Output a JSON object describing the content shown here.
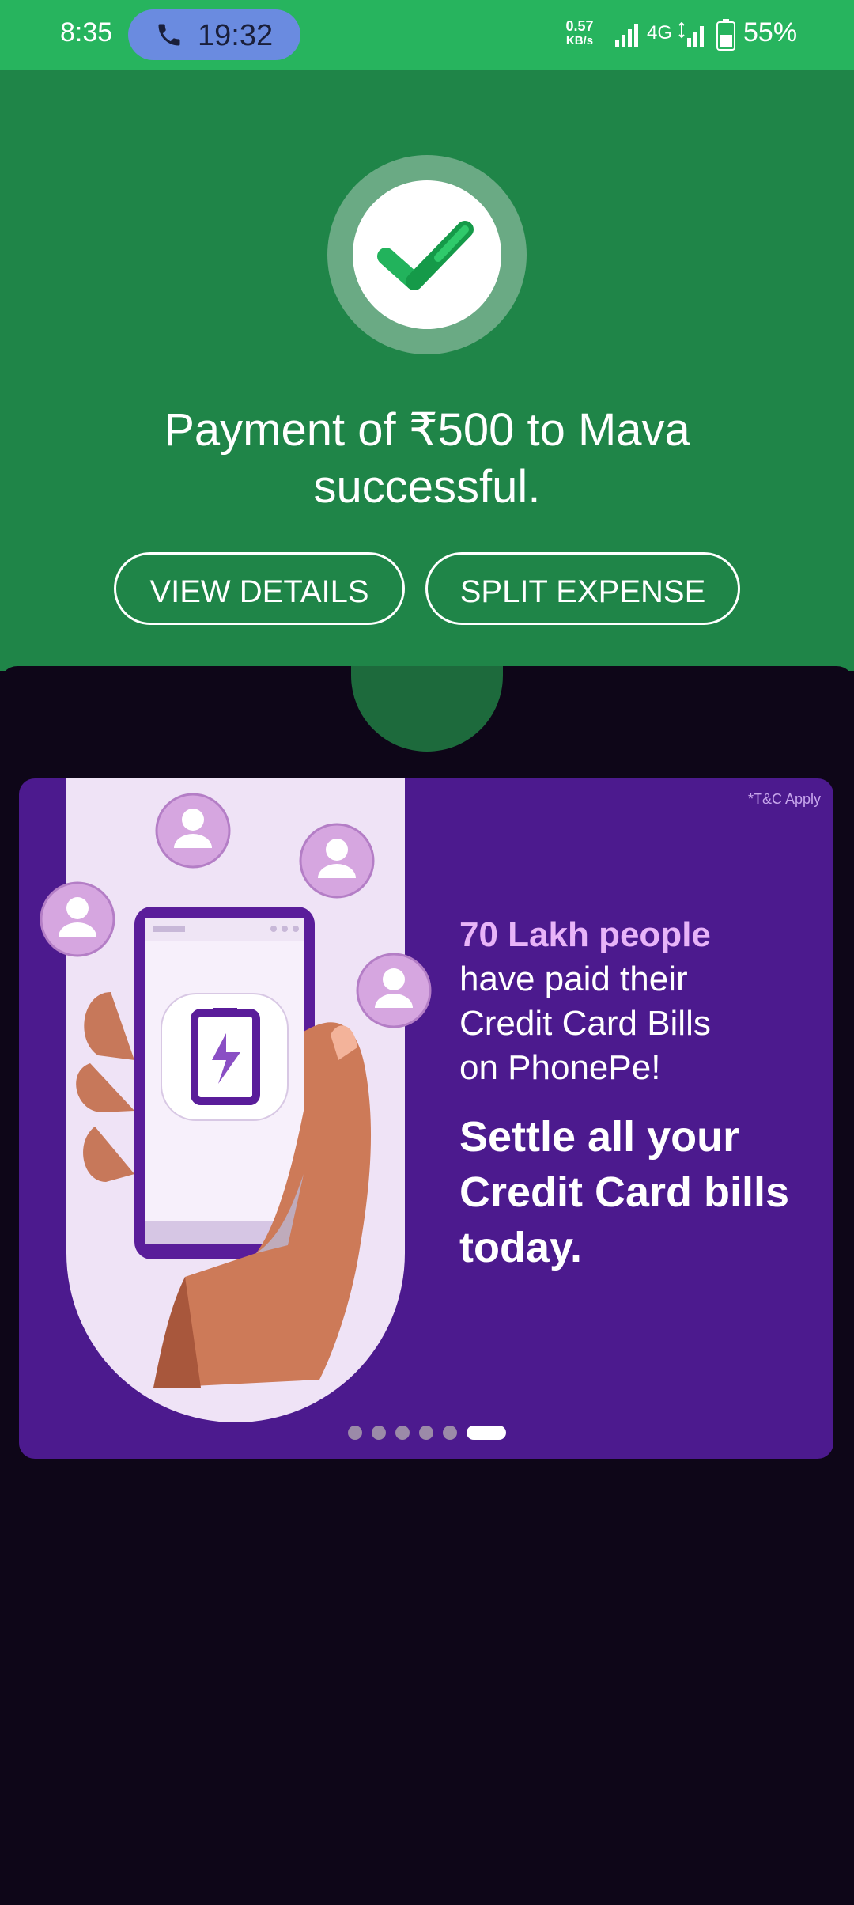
{
  "status_bar": {
    "time": "8:35",
    "call_duration": "19:32",
    "net_speed_value": "0.57",
    "net_speed_unit": "KB/s",
    "network_type": "4G",
    "battery_percent": "55%"
  },
  "success": {
    "title": "Payment of ₹500 to Mava successful.",
    "view_details_label": "VIEW DETAILS",
    "split_expense_label": "SPLIT EXPENSE"
  },
  "promo": {
    "tnc": "*T&C Apply",
    "stat": "70 Lakh people",
    "subtitle_lines": [
      "have paid their",
      "Credit Card Bills",
      "on PhonePe!"
    ],
    "cta_lines": [
      "Settle all your",
      "Credit Card bills",
      "today."
    ],
    "carousel": {
      "total_slides": 6,
      "active_index": 5
    }
  },
  "colors": {
    "status_bar": "#27b45e",
    "success_bg": "#1f8548",
    "sheet_bg": "#0e0618",
    "promo_bg": "#4c1a8e",
    "stat_accent": "#e8b4f8"
  }
}
